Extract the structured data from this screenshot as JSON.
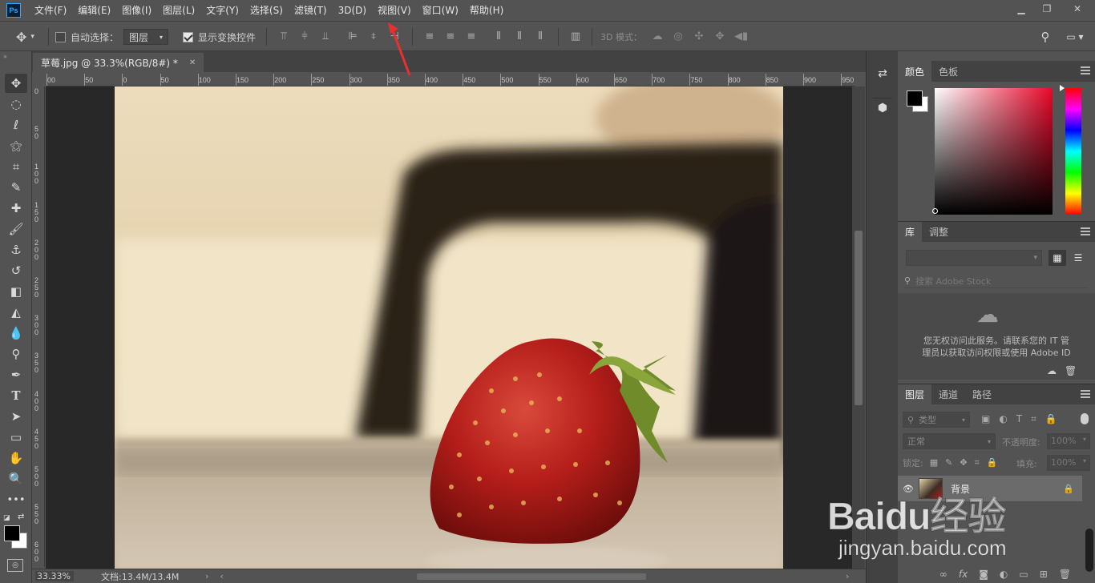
{
  "app": {
    "logo": "Ps"
  },
  "menu": [
    "文件(F)",
    "编辑(E)",
    "图像(I)",
    "图层(L)",
    "文字(Y)",
    "选择(S)",
    "滤镜(T)",
    "3D(D)",
    "视图(V)",
    "窗口(W)",
    "帮助(H)"
  ],
  "window_controls": {
    "minimize": "minimize-icon",
    "restore": "restore-icon",
    "close": "close-icon"
  },
  "options": {
    "auto_select_label": "自动选择：",
    "auto_select_checked": false,
    "auto_select_target": "图层",
    "show_transform_label": "显示变换控件",
    "show_transform_checked": true,
    "mode_3d_label": "3D 模式："
  },
  "document": {
    "tab_title": "草莓.jpg @ 33.3%(RGB/8#) *",
    "zoom": "33.33%",
    "doc_info": "文档:13.4M/13.4M"
  },
  "ruler": {
    "top": [
      "00",
      "50",
      "0",
      "50",
      "100",
      "150",
      "200",
      "250",
      "300",
      "350",
      "400",
      "450",
      "500",
      "550",
      "600",
      "650",
      "700",
      "750",
      "800",
      "850",
      "900",
      "950"
    ],
    "left": [
      "0",
      "5\n0",
      "1\n0\n0",
      "1\n5\n0",
      "2\n0\n0",
      "2\n5\n0",
      "3\n0\n0",
      "3\n5\n0",
      "4\n0\n0",
      "4\n5\n0",
      "5\n0\n0",
      "5\n5\n0",
      "6\n0\n0"
    ]
  },
  "panels": {
    "color_tabs": [
      "颜色",
      "色板"
    ],
    "library_tabs": [
      "库",
      "调整"
    ],
    "library_search_placeholder": "搜索 Adobe Stock",
    "library_message_line1": "您无权访问此服务。请联系您的 IT 管",
    "library_message_line2": "理员以获取访问权限或使用 Adobe ID",
    "layers_tabs": [
      "图层",
      "通道",
      "路径"
    ],
    "layers_filter": "类型",
    "blend_mode": "正常",
    "opacity_label": "不透明度:",
    "opacity_value": "100%",
    "lock_label": "锁定:",
    "fill_label": "填充:",
    "fill_value": "100%",
    "layer_name": "背景"
  },
  "watermark": {
    "brand": "Baidu经验",
    "url": "jingyan.baidu.com"
  },
  "colors": {
    "accent": "#31a8ff",
    "arrow": "#e8312f",
    "foreground": "#000000",
    "background": "#ffffff"
  }
}
